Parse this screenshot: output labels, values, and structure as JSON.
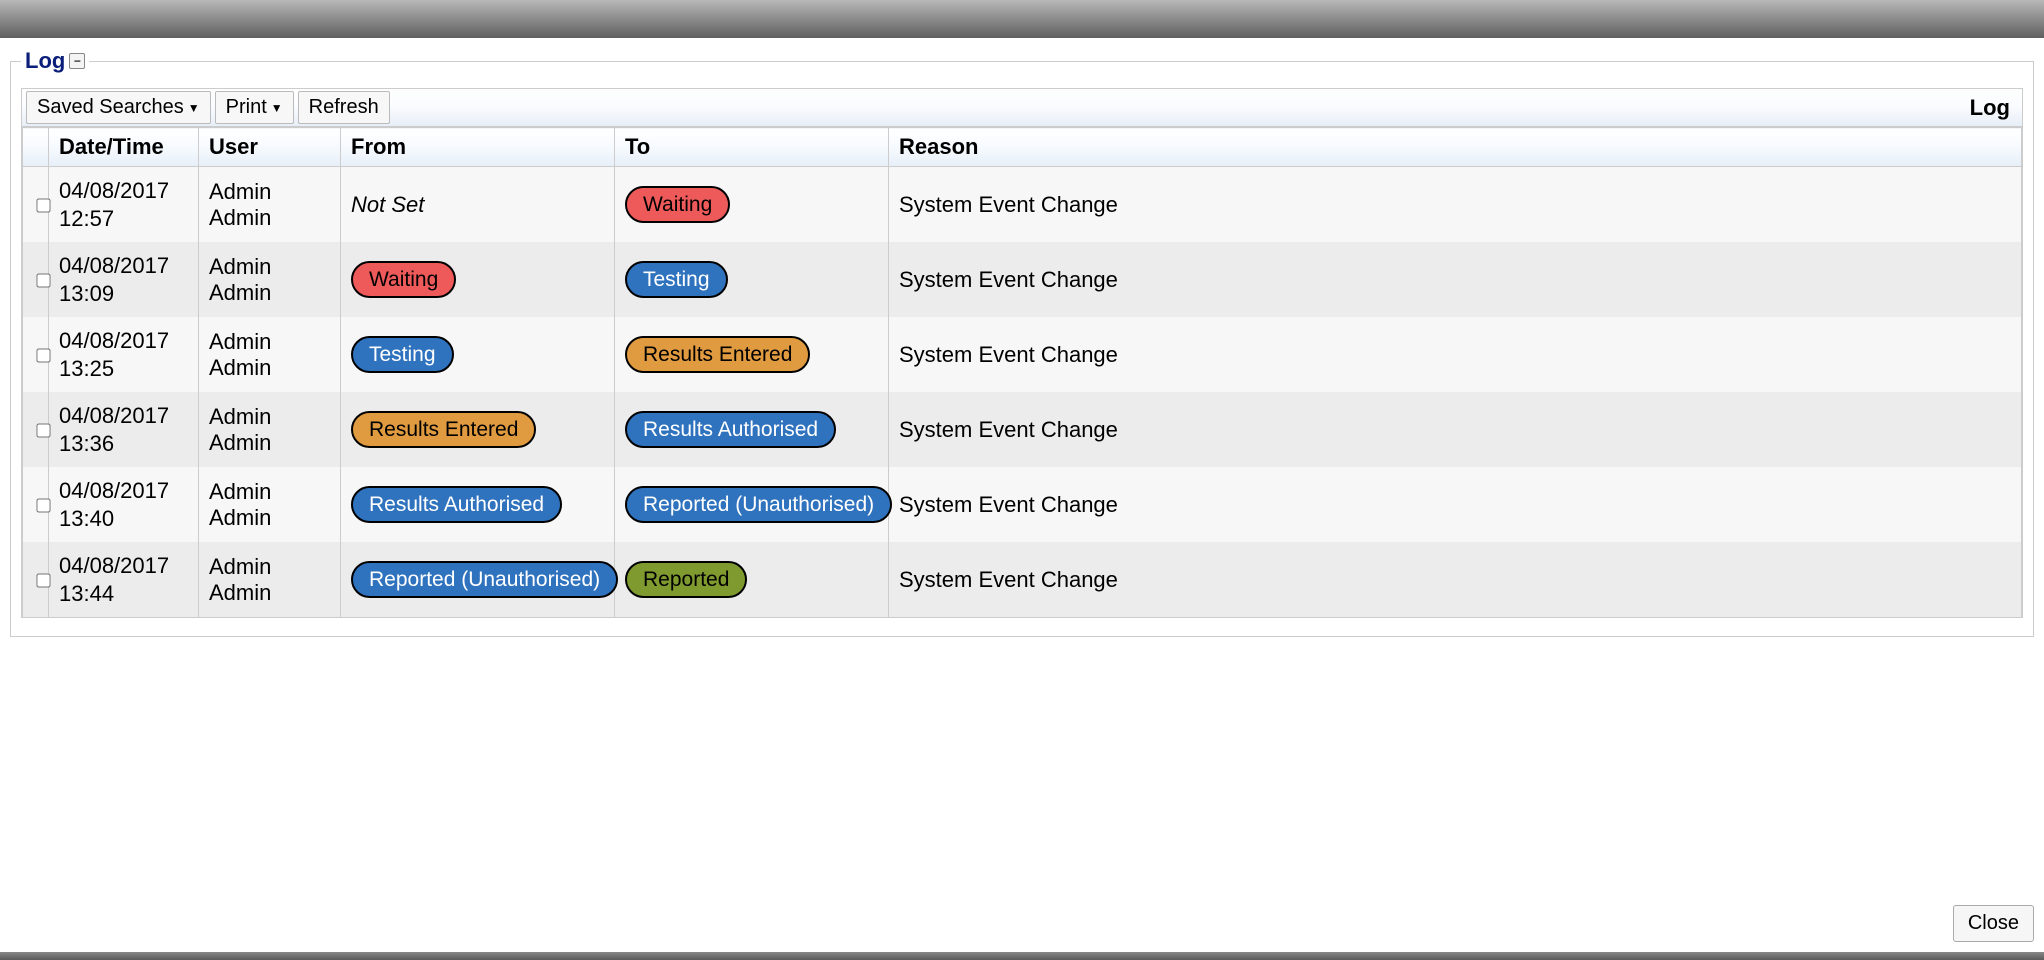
{
  "legend": {
    "title": "Log",
    "toggle_glyph": "−"
  },
  "toolbar": {
    "saved_searches": "Saved Searches",
    "print": "Print",
    "refresh": "Refresh",
    "right_title": "Log"
  },
  "columns": {
    "check": "",
    "datetime": "Date/Time",
    "user": "User",
    "from": "From",
    "to": "To",
    "reason": "Reason"
  },
  "pill_styles": {
    "Waiting": "pill-red",
    "Testing": "pill-blue",
    "Results Entered": "pill-orange",
    "Results Authorised": "pill-blue",
    "Reported (Unauthorised)": "pill-blue",
    "Reported": "pill-green"
  },
  "rows": [
    {
      "datetime": "04/08/2017 12:57",
      "user": "Admin Admin",
      "from_text": "Not Set",
      "from_pill": null,
      "to_pill": "Waiting",
      "reason": "System Event Change"
    },
    {
      "datetime": "04/08/2017 13:09",
      "user": "Admin Admin",
      "from_text": null,
      "from_pill": "Waiting",
      "to_pill": "Testing",
      "reason": "System Event Change"
    },
    {
      "datetime": "04/08/2017 13:25",
      "user": "Admin Admin",
      "from_text": null,
      "from_pill": "Testing",
      "to_pill": "Results Entered",
      "reason": "System Event Change"
    },
    {
      "datetime": "04/08/2017 13:36",
      "user": "Admin Admin",
      "from_text": null,
      "from_pill": "Results Entered",
      "to_pill": "Results Authorised",
      "reason": "System Event Change"
    },
    {
      "datetime": "04/08/2017 13:40",
      "user": "Admin Admin",
      "from_text": null,
      "from_pill": "Results Authorised",
      "to_pill": "Reported (Unauthorised)",
      "reason": "System Event Change"
    },
    {
      "datetime": "04/08/2017 13:44",
      "user": "Admin Admin",
      "from_text": null,
      "from_pill": "Reported (Unauthorised)",
      "to_pill": "Reported",
      "reason": "System Event Change"
    }
  ],
  "footer": {
    "close": "Close"
  }
}
